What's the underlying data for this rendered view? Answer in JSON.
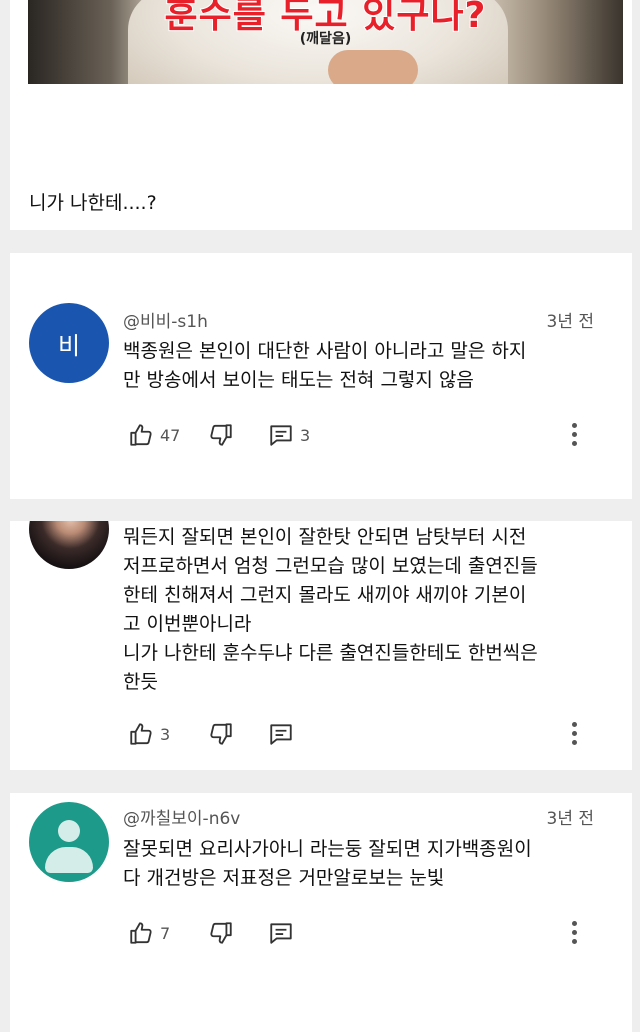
{
  "video": {
    "thumbnail_caption": "훈수를 두고 있구나?",
    "thumbnail_subcaption": "(깨달음)",
    "text": "니가 나한테....?"
  },
  "comments": [
    {
      "avatar_letter": "비",
      "handle": "@비비-s1h",
      "time": "3년 전",
      "text": "백종원은 본인이 대단한 사람이 아니라고 말은 하지\n만 방송에서 보이는 태도는 전혀 그렇지 않음",
      "likes": "47",
      "replies": "3"
    },
    {
      "text": "뭐든지 잘되면 본인이 잘한탓 안되면 남탓부터 시전\n저프로하면서 엄청 그런모습 많이 보였는데 출연진들\n한테 친해져서 그런지 몰라도 새끼야 새끼야 기본이\n고 이번뿐아니라\n니가 나한테 훈수두냐 다른 출연진들한테도 한번씩은\n한듯",
      "likes": "3"
    },
    {
      "handle": "@까칠보이-n6v",
      "time": "3년 전",
      "text": "잘못되면 요리사가아니 라는둥 잘되면 지가백종원이\n다 개건방은 저표정은 거만알로보는 눈빛",
      "likes": "7"
    }
  ],
  "icons": [
    "thumb-up-icon",
    "thumb-down-icon",
    "reply-comment-icon",
    "more-vertical-icon"
  ],
  "colors": {
    "avatar_blue": "#1a56b0",
    "avatar_teal": "#1d9a89",
    "caption_red": "#e8202a"
  }
}
